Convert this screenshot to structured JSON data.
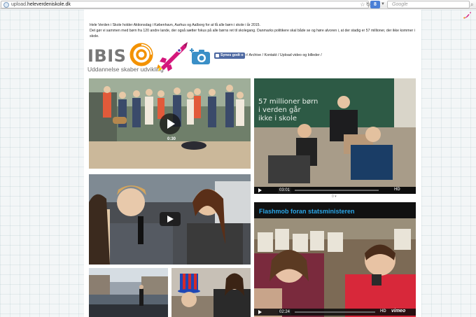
{
  "browser": {
    "url_prefix": "upload.",
    "url_domain": "heleverdeniskole.dk",
    "search_engine_label": "8",
    "search_placeholder": "Google"
  },
  "intro": {
    "line1": "Hele Verden i Skole holder Aktionsdag i København, Aarhus og Aalborg for at få alle børn i skole i år 2015.",
    "line2": "Det gør vi sammen med børn fra 120 andre lande, der også sætter fokus på alle børns ret til skolegang. Danmarks politikere skal både se og høre alvoren i, at der stadig er 57 millioner, der ikke kommer i",
    "line3": "skole."
  },
  "logo": {
    "name": "IBIS",
    "tagline": "Uddannelse skaber udvikling"
  },
  "like_button": {
    "label": "Synes godt o"
  },
  "nav": {
    "links": [
      "Archive",
      "Kontakt",
      "Upload video og billeder"
    ],
    "prefix": "r/",
    "separator": " / ",
    "suffix": " /"
  },
  "videos": {
    "v1": {
      "duration": "0:30"
    },
    "v2": {
      "slide_text_1": "57 millioner børn",
      "slide_text_2": "i verden går",
      "slide_text_3": "ikke i skole",
      "time": "03:01",
      "hd": "HD",
      "sub_count": "0 ▾"
    },
    "v4": {
      "title": "Flashmob foran statsministeren",
      "time": "02:24",
      "hd": "HD",
      "brand": "vimeo"
    }
  },
  "colors": {
    "ibis_orange": "#f39200",
    "rocket_magenta": "#d4177c",
    "camera_blue": "#3a8fc7",
    "facebook_blue": "#4e69a2",
    "flashmob_title": "#2aa6e8"
  }
}
